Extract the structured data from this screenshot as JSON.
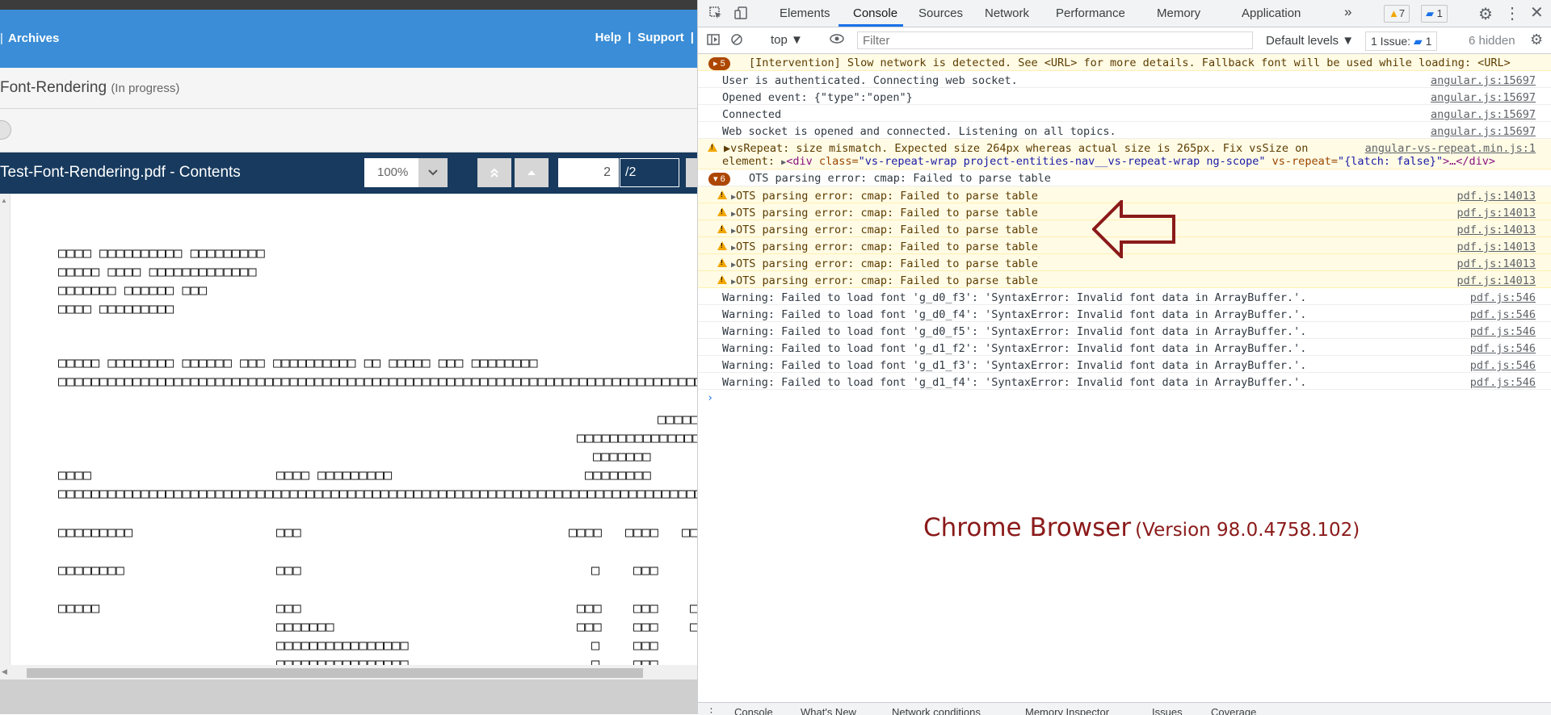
{
  "app": {
    "header": {
      "archives": "Archives",
      "help": "Help",
      "support": "Support"
    },
    "doc_title": "Font-Rendering",
    "doc_status": "(In progress)",
    "viewer": {
      "title": "Test-Font-Rendering.pdf - Contents",
      "zoom": "100%",
      "page_current": "2",
      "page_total": "/2"
    },
    "pdf_lines": [
      "□□□□ □□□□□□□□□□ □□□□□□□□□",
      "□□□□□ □□□□ □□□□□□□□□□□□□",
      "□□□□□□□ □□□□□□ □□□",
      "□□□□ □□□□□□□□□",
      "□□□□□ □□□□□□□□ □□□□□□ □□□ □□□□□□□□□□ □□ □□□□□ □□□ □□□□□□□□",
      "□□□□□□□□□□□□□□□□□□□□□□□□□□□□□□□□□□□□□□□□□□□□□□□□□□□□□□□□□□□□□□□□□□□□□□□□□□□□□□",
      "□□□□□",
      "□□□□□□□□□□□□□□□□",
      "□□□□□□□",
      "□□□□",
      "□□□□ □□□□□□□□□",
      "□□□□□□□□",
      "□□□□□□□□□□□□□□□□□□□□□□□□□□□□□□□□□□□□□□□□□□□□□□□□□□□□□□□□□□□□□□□□□□□□□□□□□□□□□□",
      "□□□□□□□□□",
      "□□□",
      "□□□□",
      "□□□□",
      "□□",
      "□□□□□□□□",
      "□□□",
      "□",
      "□□□",
      "□□□□□",
      "□□□",
      "□□□",
      "□□□",
      "□",
      "□□□□□□□",
      "□□□",
      "□□□",
      "□",
      "□□□□□□□□□□□□□□□□",
      "□",
      "□□□",
      "□□□□□□□□□□□□□□□□",
      "□",
      "□□□"
    ]
  },
  "devtools": {
    "tabs": [
      "Elements",
      "Console",
      "Sources",
      "Network",
      "Performance",
      "Memory",
      "Application"
    ],
    "more_tabs": "»",
    "warn_badge": "7",
    "msg_badge": "1",
    "toolbar": {
      "context": "top ▼",
      "filter_placeholder": "Filter",
      "levels": "Default levels ▼",
      "issues_label": "1 Issue:",
      "issues_count": "1",
      "hidden": "6 hidden"
    },
    "console": {
      "intervention_count": "5",
      "intervention_msg": "[Intervention] Slow network is detected. See <URL> for more details. Fallback font will be used while loading: <URL>",
      "info_rows": [
        {
          "msg": "User is authenticated. Connecting web socket.",
          "src": "angular.js:15697"
        },
        {
          "msg": "Opened event: {\"type\":\"open\"}",
          "src": "angular.js:15697"
        },
        {
          "msg": "Connected",
          "src": "angular.js:15697"
        },
        {
          "msg": "Web socket is opened and connected. Listening on all topics.",
          "src": "angular.js:15697"
        }
      ],
      "vsrepeat": {
        "msg": "▶vsRepeat: size mismatch. Expected size 264px whereas actual size is 265px. Fix vsSize on",
        "src": "angular-vs-repeat.min.js:1",
        "element_prefix": "element:",
        "tag_open": "<div ",
        "attr1": "class=",
        "val1": "\"vs-repeat-wrap project-entities-nav__vs-repeat-wrap ng-scope\"",
        "attr2": " vs-repeat=",
        "val2": "\"{latch: false}\"",
        "tag_close": ">…</div>"
      },
      "ots_group_count": "6",
      "ots_group_msg": "OTS parsing error: cmap: Failed to parse table",
      "ots_rows": [
        {
          "msg": "OTS parsing error: cmap: Failed to parse table",
          "src": "pdf.js:14013"
        },
        {
          "msg": "OTS parsing error: cmap: Failed to parse table",
          "src": "pdf.js:14013"
        },
        {
          "msg": "OTS parsing error: cmap: Failed to parse table",
          "src": "pdf.js:14013"
        },
        {
          "msg": "OTS parsing error: cmap: Failed to parse table",
          "src": "pdf.js:14013"
        },
        {
          "msg": "OTS parsing error: cmap: Failed to parse table",
          "src": "pdf.js:14013"
        },
        {
          "msg": "OTS parsing error: cmap: Failed to parse table",
          "src": "pdf.js:14013"
        }
      ],
      "font_warnings": [
        {
          "msg": "Warning: Failed to load font 'g_d0_f3': 'SyntaxError: Invalid font data in ArrayBuffer.'.",
          "src": "pdf.js:546"
        },
        {
          "msg": "Warning: Failed to load font 'g_d0_f4': 'SyntaxError: Invalid font data in ArrayBuffer.'.",
          "src": "pdf.js:546"
        },
        {
          "msg": "Warning: Failed to load font 'g_d0_f5': 'SyntaxError: Invalid font data in ArrayBuffer.'.",
          "src": "pdf.js:546"
        },
        {
          "msg": "Warning: Failed to load font 'g_d1_f2': 'SyntaxError: Invalid font data in ArrayBuffer.'.",
          "src": "pdf.js:546"
        },
        {
          "msg": "Warning: Failed to load font 'g_d1_f3': 'SyntaxError: Invalid font data in ArrayBuffer.'.",
          "src": "pdf.js:546"
        },
        {
          "msg": "Warning: Failed to load font 'g_d1_f4': 'SyntaxError: Invalid font data in ArrayBuffer.'.",
          "src": "pdf.js:546"
        }
      ],
      "prompt": "›"
    },
    "drawer_tabs": [
      "Console",
      "What's New",
      "Network conditions",
      "Memory Inspector",
      "Issues",
      "Coverage"
    ]
  },
  "annotation": {
    "label_main": "Chrome Browser",
    "label_version": "(Version 98.0.4758.102)"
  }
}
